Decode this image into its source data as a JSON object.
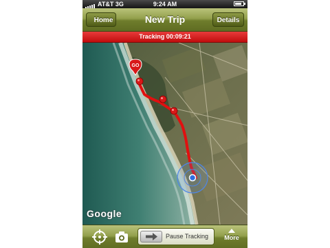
{
  "status_bar": {
    "carrier": "AT&T",
    "network": "3G",
    "time": "9:24 AM"
  },
  "nav": {
    "title": "New Trip",
    "back_label": "Home",
    "right_label": "Details"
  },
  "tracking": {
    "text": "Tracking 00:09:21"
  },
  "map": {
    "start_marker_label": "GO",
    "attribution": "Google",
    "route_color": "#e01010",
    "location_color": "#2f6fe0"
  },
  "toolbar": {
    "compass_icon": "crosshair-compass-icon",
    "camera_icon": "camera-icon",
    "pause_label": "Pause Tracking",
    "more_label": "More"
  },
  "colors": {
    "bar_green": "#7d8a35",
    "tracking_red": "#d21a1a"
  }
}
